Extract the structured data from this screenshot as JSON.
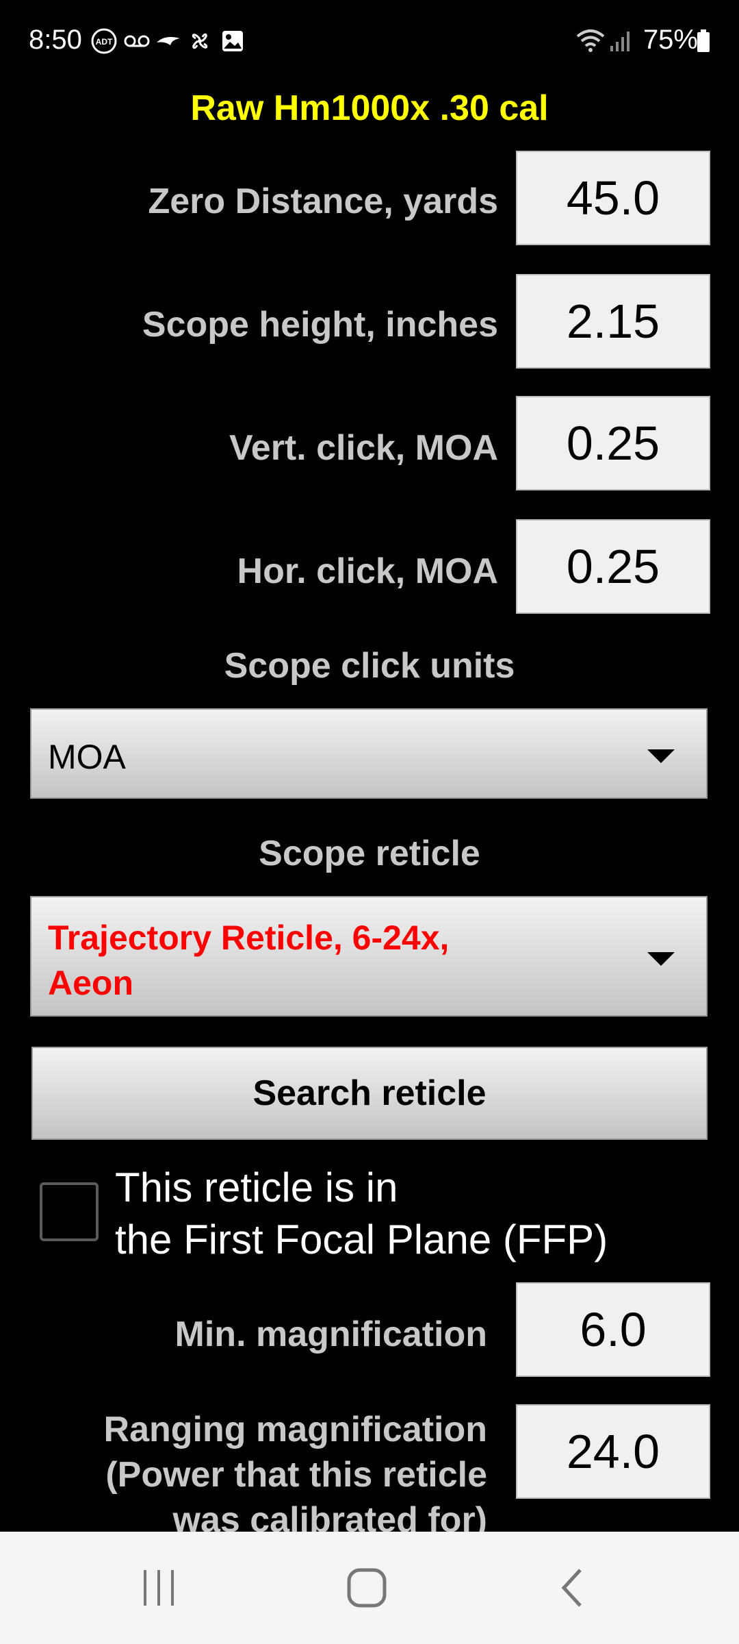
{
  "status_bar": {
    "time": "8:50",
    "battery": "75%",
    "icons": [
      "adt-icon",
      "voicemail-icon",
      "ravens-icon",
      "pinwheel-icon",
      "image-icon",
      "wifi-icon",
      "signal-icon",
      "battery-icon"
    ]
  },
  "app": {
    "title": "Raw Hm1000x .30 cal"
  },
  "fields": {
    "zero_distance": {
      "label": "Zero Distance, yards",
      "value": "45.0"
    },
    "scope_height": {
      "label": "Scope height, inches",
      "value": "2.15"
    },
    "vert_click": {
      "label": "Vert. click, MOA",
      "value": "0.25"
    },
    "hor_click": {
      "label": "Hor. click, MOA",
      "value": "0.25"
    }
  },
  "scope_click_units": {
    "label": "Scope click units",
    "selected": "MOA"
  },
  "scope_reticle": {
    "label": "Scope reticle",
    "selected_line1": "Trajectory Reticle, 6-24x,",
    "selected_line2": "Aeon",
    "selected_color": "#ff0000"
  },
  "search_button": {
    "label": "Search reticle"
  },
  "ffp_checkbox": {
    "line1": "This reticle is in",
    "line2": "the First Focal Plane (FFP)",
    "checked": false
  },
  "min_magnification": {
    "label": "Min. magnification",
    "value": "6.0"
  },
  "ranging_magnification": {
    "label_line1": "Ranging magnification",
    "label_line2": "(Power that this reticle",
    "label_line3": "was calibrated for)",
    "value": "24.0"
  },
  "nav_bar": {
    "buttons": [
      "recent-apps-icon",
      "home-icon",
      "back-icon"
    ]
  }
}
